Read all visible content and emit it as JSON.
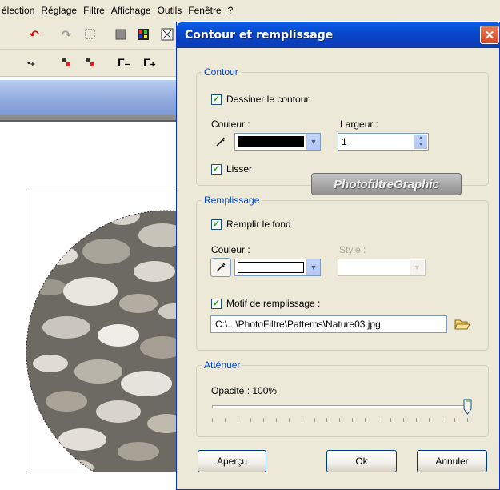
{
  "app": {
    "menu": [
      "élection",
      "Réglage",
      "Filtre",
      "Affichage",
      "Outils",
      "Fenêtre",
      "?"
    ]
  },
  "dialog": {
    "title": "Contour et remplissage",
    "close_label": "✕",
    "watermark": "PhotofiltreGraphic",
    "contour": {
      "legend": "Contour",
      "draw_outline_label": "Dessiner le contour",
      "draw_outline_checked": true,
      "color_label": "Couleur :",
      "color_value": "#000000",
      "width_label": "Largeur :",
      "width_value": "1",
      "smooth_label": "Lisser",
      "smooth_checked": true
    },
    "fill": {
      "legend": "Remplissage",
      "fill_bg_label": "Remplir le fond",
      "fill_bg_checked": true,
      "color_label": "Couleur :",
      "color_value": "#ffffff",
      "style_label": "Style :",
      "pattern_label": "Motif de remplissage :",
      "pattern_checked": true,
      "pattern_path": "C:\\...\\PhotoFiltre\\Patterns\\Nature03.jpg"
    },
    "attenuate": {
      "legend": "Atténuer",
      "opacity_label": "Opacité : 100%",
      "opacity_value": 100
    },
    "buttons": {
      "preview": "Aperçu",
      "ok": "Ok",
      "cancel": "Annuler"
    }
  },
  "colors": {
    "title_bar": "#0a4fd8",
    "legend_text": "#0046d5",
    "dialog_bg": "#ece9d8",
    "close_button": "#d4482a"
  }
}
